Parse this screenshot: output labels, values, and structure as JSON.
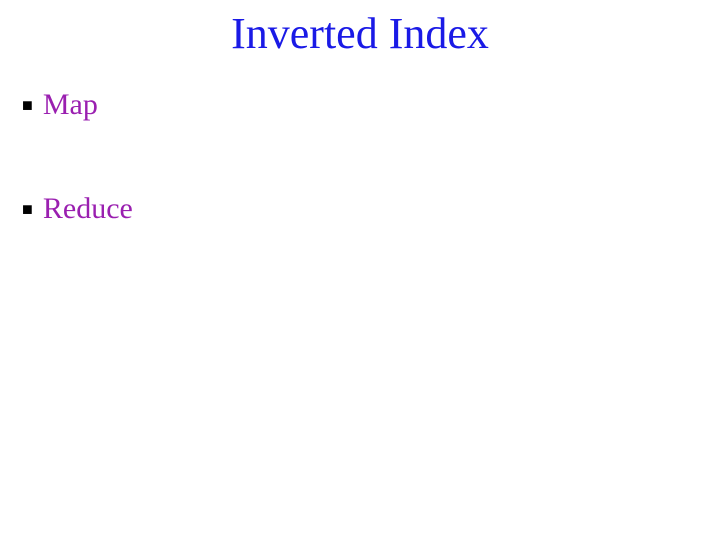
{
  "title": "Inverted Index",
  "bullets": [
    {
      "marker": "■",
      "text": "Map"
    },
    {
      "marker": "■",
      "text": "Reduce"
    }
  ]
}
